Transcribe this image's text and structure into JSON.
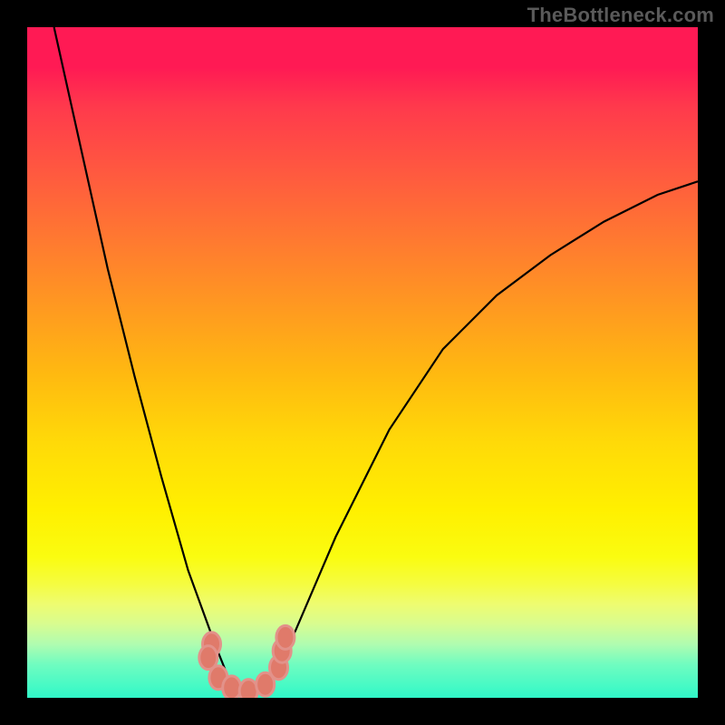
{
  "watermark": "TheBottleneck.com",
  "chart_data": {
    "type": "line",
    "title": "",
    "xlabel": "",
    "ylabel": "",
    "xlim": [
      0,
      100
    ],
    "ylim": [
      0,
      100
    ],
    "grid": false,
    "legend": false,
    "note": "No axis ticks or labels are visible; curve values are pixel-estimated from the figure.",
    "series": [
      {
        "name": "left-curve",
        "x": [
          4,
          8,
          12,
          16,
          20,
          24,
          28,
          30,
          32
        ],
        "values": [
          100,
          82,
          64,
          48,
          33,
          19,
          8,
          3,
          1
        ]
      },
      {
        "name": "right-curve",
        "x": [
          36,
          40,
          46,
          54,
          62,
          70,
          78,
          86,
          94,
          100
        ],
        "values": [
          2,
          10,
          24,
          40,
          52,
          60,
          66,
          71,
          75,
          77
        ]
      }
    ],
    "markers": {
      "name": "highlight-blobs",
      "points": [
        {
          "x": 27.5,
          "y": 8
        },
        {
          "x": 27.0,
          "y": 6
        },
        {
          "x": 28.5,
          "y": 3
        },
        {
          "x": 30.5,
          "y": 1.5
        },
        {
          "x": 33.0,
          "y": 1
        },
        {
          "x": 35.5,
          "y": 2
        },
        {
          "x": 37.5,
          "y": 4.5
        },
        {
          "x": 38.0,
          "y": 7
        },
        {
          "x": 38.5,
          "y": 9
        }
      ]
    },
    "background_gradient": {
      "description": "vertical gradient roughly encoding goodness: top=red (bad), bottom=green (good)",
      "stops": [
        {
          "pos": 0,
          "color": "#ff1a54"
        },
        {
          "pos": 50,
          "color": "#ffcc00"
        },
        {
          "pos": 83,
          "color": "#f5fc40"
        },
        {
          "pos": 100,
          "color": "#30f8c8"
        }
      ]
    }
  }
}
